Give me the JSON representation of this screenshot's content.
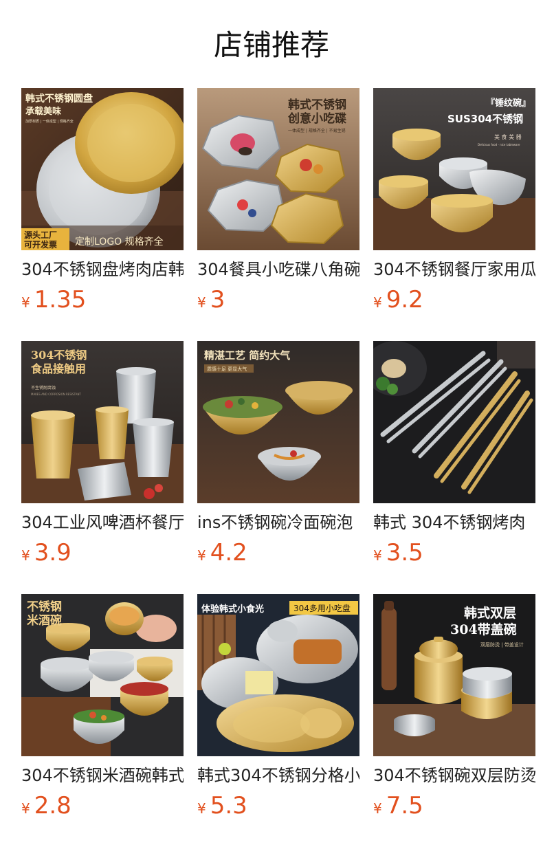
{
  "page": {
    "title": "店铺推荐"
  },
  "currency_symbol": "¥",
  "products": [
    {
      "name": "304不锈钢盘烤肉店韩",
      "price": "1.35",
      "image": {
        "icon": "round-plates",
        "lines": [
          "韩式不锈钢圆盘",
          "承载美味",
          "加厚材质 | 一体成型 | 规格齐全",
          "源头工厂",
          "可开发票",
          "定制LOGO 规格齐全"
        ]
      }
    },
    {
      "name": "304餐具小吃碟八角碗",
      "price": "3",
      "image": {
        "icon": "octagon-dishes",
        "lines": [
          "韩式不锈钢",
          "创意小吃碟",
          "一体成型 | 规格齐全 | 不易生锈"
        ]
      }
    },
    {
      "name": "304不锈钢餐厅家用瓜",
      "price": "9.2",
      "image": {
        "icon": "hammered-bowls",
        "lines": [
          "『锤纹碗』",
          "SUS304不锈钢",
          "美 食 美 器",
          "Delicious food · nice tableware"
        ]
      }
    },
    {
      "name": "304工业风啤酒杯餐厅",
      "price": "3.9",
      "image": {
        "icon": "beer-cups",
        "lines": [
          "304不锈钢",
          "食品接触用",
          "不生锈耐腐蚀",
          "MAKES AND CORROSION RESISTANT"
        ]
      }
    },
    {
      "name": "ins不锈钢碗冷面碗泡",
      "price": "4.2",
      "image": {
        "icon": "salad-bowls",
        "lines": [
          "精湛工艺 简约大气",
          "质感十足 更显大气"
        ]
      }
    },
    {
      "name": "韩式 304不锈钢烤肉",
      "price": "3.5",
      "image": {
        "icon": "bbq-tongs",
        "lines": []
      }
    },
    {
      "name": "304不锈钢米酒碗韩式",
      "price": "2.8",
      "image": {
        "icon": "rice-wine-bowls",
        "lines": [
          "不锈钢",
          "米酒碗"
        ]
      }
    },
    {
      "name": "韩式304不锈钢分格小",
      "price": "5.3",
      "image": {
        "icon": "divided-plates",
        "lines": [
          "体验韩式小食光",
          "304多用小吃盘"
        ]
      }
    },
    {
      "name": "304不锈钢碗双层防烫",
      "price": "7.5",
      "image": {
        "icon": "lidded-bowls",
        "lines": [
          "韩式双层",
          "304带盖碗",
          "双层防烫 | 带盖设计"
        ]
      }
    }
  ],
  "colors": {
    "price": "#e2501e",
    "title": "#111111",
    "gold": "#d4a93c",
    "silver": "#c9ccd0"
  }
}
